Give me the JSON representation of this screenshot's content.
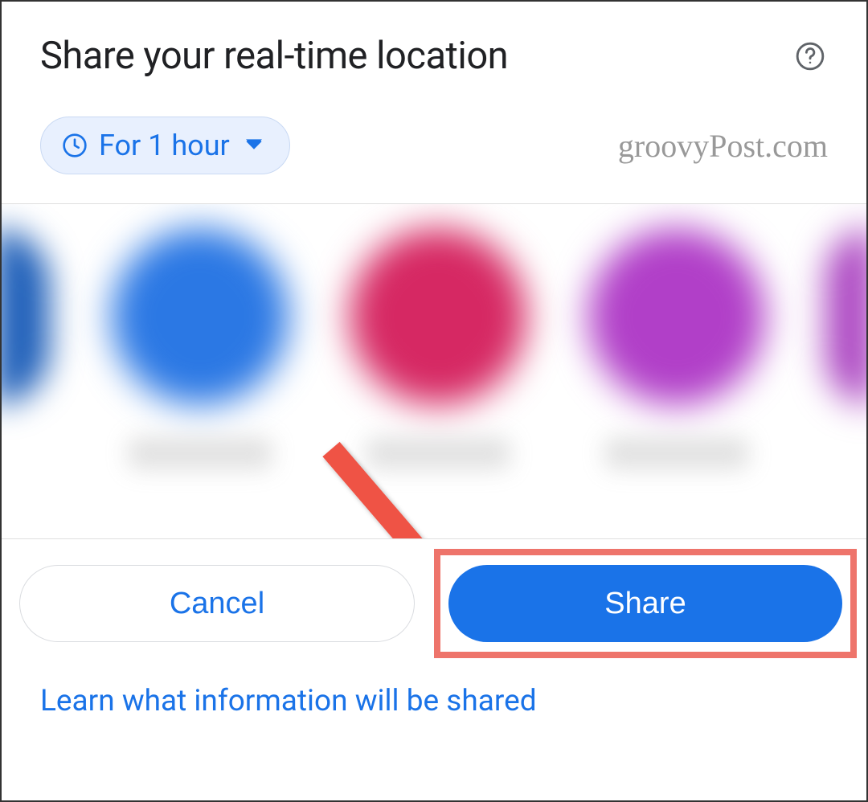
{
  "header": {
    "title": "Share your real-time location"
  },
  "duration": {
    "label": "For 1 hour"
  },
  "watermark": {
    "text": "groovyPost.com"
  },
  "contacts": {
    "blurred_avatars": [
      {
        "color": "#2b78e4"
      },
      {
        "color": "#d62863"
      },
      {
        "color": "#b13fc8"
      }
    ]
  },
  "actions": {
    "cancel_label": "Cancel",
    "share_label": "Share"
  },
  "footer": {
    "learn_link": "Learn what information will be shared"
  },
  "colors": {
    "primary": "#1a73e8",
    "chip_bg": "#e8f0fe",
    "annotation": "#ee746b"
  }
}
